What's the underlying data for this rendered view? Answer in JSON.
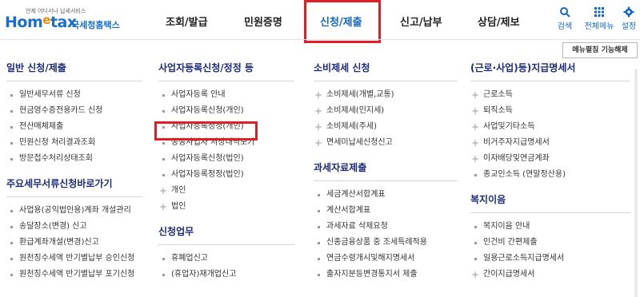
{
  "logo": {
    "tagline": "언제 어디서나 납세서비스",
    "brand": "Hometax",
    "brand_ko": "국세청홈택스"
  },
  "nav": [
    {
      "label": "조회/발급",
      "active": false
    },
    {
      "label": "민원증명",
      "active": false
    },
    {
      "label": "신청/제출",
      "active": true
    },
    {
      "label": "신고/납부",
      "active": false
    },
    {
      "label": "상담/제보",
      "active": false
    }
  ],
  "tools": {
    "search": "검색",
    "all_menu": "전체메뉴",
    "settings": "설정"
  },
  "fold_button": "메뉴펼침 기능해제",
  "columns": [
    {
      "title": "일반 신청/제출",
      "items": [
        "일반세무서류 신청",
        "현금영수증전용카드 신청",
        "전산매체제출",
        "민원신청 처리결과조회",
        "방문접수처리상태조회"
      ],
      "sub_title": "주요세무서류신청바로가기",
      "sub_items": [
        "사업용(공익법인용)계좌 개설관리",
        "송달장소(변경) 신고",
        "환급계좌개설(변경)신고",
        "원천징수세액 반기별납부 승인신청",
        "원천징수세액 반기별납부 포기신청"
      ]
    },
    {
      "title": "사업자등록신청/정정 등",
      "items": [
        "사업자등록 안내",
        "사업자등록신청(개인)",
        "사업자등록정정(개인)",
        "공동사업자 저장내역보기",
        "사업자등록신청(법인)",
        "사업자등록정정(법인)",
        "개인",
        "법인"
      ],
      "sub_title": "신청업무",
      "sub_items": [
        "휴폐업신고",
        "(휴업자)재개업신고"
      ]
    },
    {
      "title": "소비제세 신청",
      "items": [
        "소비제세(개별,교통)",
        "소비제세(인지세)",
        "소비제세(주세)",
        "면세미납세신청신고"
      ],
      "sub_title": "과세자료제출",
      "sub_items": [
        "세금계산서합계표",
        "계산서합계표",
        "과세자료 삭제요청",
        "신종금융상품 중 조세특례적용",
        "연금수령개시및해지명세서",
        "출자지분등변경통지서 제출"
      ]
    },
    {
      "title": "(근로·사업)등)지급명세서",
      "items": [
        "근로소득",
        "퇴직소득",
        "사업및기타소득",
        "비거주자지급명세서",
        "이자배당및연금계좌",
        "종교인소득 (연말정산용)"
      ],
      "sub_title": "복지이음",
      "sub_items": [
        "복지이음 안내",
        "인건비 간편제출",
        "일용근로소득지급명세서",
        "간이지급명세서"
      ]
    }
  ]
}
